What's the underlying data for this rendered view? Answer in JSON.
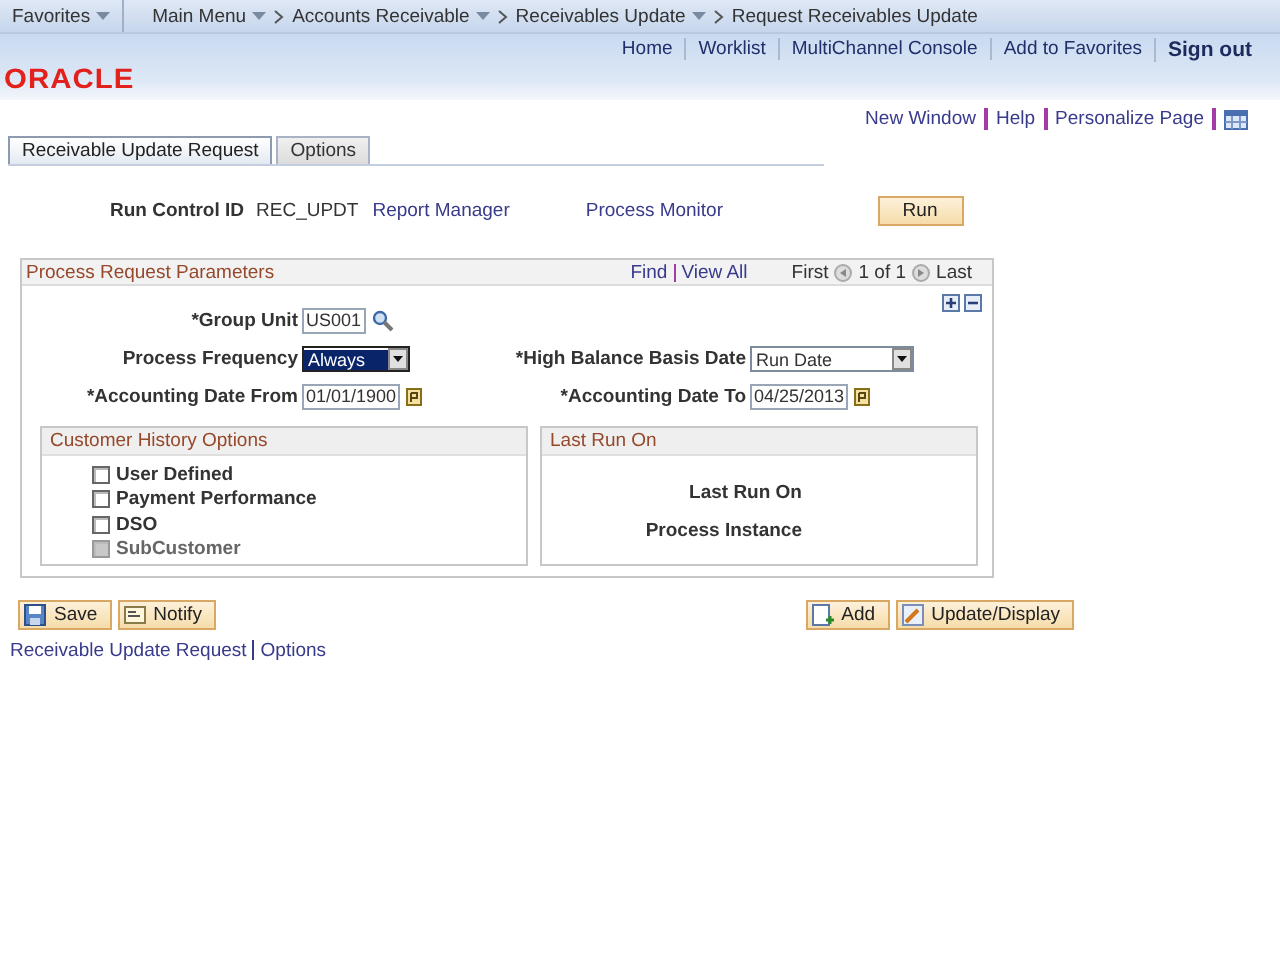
{
  "nav": {
    "favorites": {
      "label": "Favorites",
      "has_menu": true
    },
    "breadcrumbs": [
      {
        "label": "Main Menu",
        "has_menu": true
      },
      {
        "label": "Accounts Receivable",
        "has_menu": true
      },
      {
        "label": "Receivables Update",
        "has_menu": true
      },
      {
        "label": "Request Receivables Update",
        "has_menu": false
      }
    ]
  },
  "header_links": [
    {
      "label": "Home",
      "kind": "link"
    },
    {
      "label": "Worklist",
      "kind": "link"
    },
    {
      "label": "MultiChannel Console",
      "kind": "link"
    },
    {
      "label": "Add to Favorites",
      "kind": "link"
    },
    {
      "label": "Sign out",
      "kind": "signout"
    }
  ],
  "logo": "ORACLE",
  "page_links": [
    "New Window",
    "Help",
    "Personalize Page"
  ],
  "tabs": [
    {
      "label": "Receivable Update Request",
      "selected": true
    },
    {
      "label": "Options",
      "selected": false
    }
  ],
  "run_control": {
    "label": "Run Control ID",
    "value": "REC_UPDT",
    "links": [
      "Report Manager",
      "Process Monitor"
    ],
    "run_button": "Run"
  },
  "parameters": {
    "title": "Process Request Parameters",
    "find": "Find",
    "view_all": "View All",
    "first": "First",
    "count": "1 of 1",
    "last": "Last",
    "rows": [
      [
        {
          "label": "*Group Unit",
          "kind": "lookup",
          "value": "US001",
          "focused": false
        }
      ],
      [
        {
          "label": "Process Frequency",
          "kind": "select",
          "value": "Always",
          "focused": true
        },
        {
          "label": "*High Balance Basis Date",
          "kind": "select",
          "value": "Run Date",
          "focused": false
        }
      ],
      [
        {
          "label": "*Accounting Date From",
          "kind": "date",
          "value": "01/01/1900",
          "focused": false
        },
        {
          "label": "*Accounting Date To",
          "kind": "date",
          "value": "04/25/2013",
          "focused": false
        }
      ]
    ]
  },
  "customer_history": {
    "title": "Customer History Options",
    "options": [
      {
        "label": "User Defined",
        "checked": false,
        "disabled": false
      },
      {
        "label": "Payment Performance",
        "checked": false,
        "disabled": false
      },
      {
        "label": "DSO",
        "checked": false,
        "disabled": false
      },
      {
        "label": "SubCustomer",
        "checked": false,
        "disabled": true
      }
    ]
  },
  "last_run": {
    "title": "Last Run On",
    "fields": [
      "Last Run On",
      "Process Instance"
    ]
  },
  "buttons_left": [
    {
      "label": "Save",
      "kind": "save"
    },
    {
      "label": "Notify",
      "kind": "notify"
    }
  ],
  "buttons_right": [
    {
      "label": "Add",
      "kind": "add"
    },
    {
      "label": "Update/Display",
      "kind": "update"
    }
  ],
  "footer_links": [
    "Receivable Update Request",
    "Options"
  ]
}
